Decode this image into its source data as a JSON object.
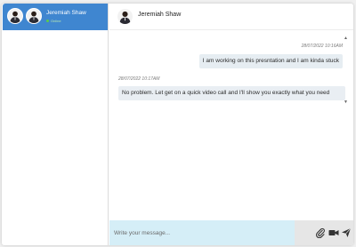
{
  "sidebar": {
    "contacts": [
      {
        "name": "Jeremiah Shaw",
        "status": "Online",
        "active": true
      }
    ]
  },
  "chat": {
    "header": {
      "name": "Jeremiah Shaw"
    },
    "messages": [
      {
        "direction": "sent",
        "timestamp": "28/07/2022 10:16AM",
        "text": "I am working on this presntation and I am kinda stuck"
      },
      {
        "direction": "received",
        "timestamp": "28/07/2022 10:17AM",
        "text": "No problem. Let get on a quick video call and I'll show you exactly what you need"
      }
    ],
    "input": {
      "placeholder": "Write your message...",
      "value": ""
    },
    "actions": {
      "attach_icon": "paperclip-icon",
      "video_icon": "video-camera-icon",
      "send_icon": "send-icon"
    }
  },
  "colors": {
    "accent": "#3f86d0",
    "input_bg": "#d5eef7",
    "online": "#5ccc4a"
  }
}
